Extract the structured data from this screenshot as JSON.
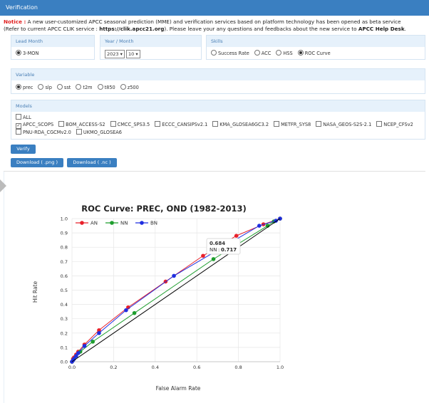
{
  "header": {
    "title": "Verification"
  },
  "notice": {
    "label": "Notice :",
    "text1": " A new user-customized APCC seasonal prediction (MME) and verification services based on platform technology has been opened as beta service",
    "text2": "(Refer to current APCC CLIK service : ",
    "link": "https://clik.apcc21.org",
    "text3": "). Please leave your any questions and feedbacks about the new service to ",
    "helpdesk": "APCC Help Desk",
    "end": "."
  },
  "lead": {
    "label": "Lead Month",
    "value": "3-MON"
  },
  "yearmonth": {
    "label": "Year / Month",
    "year": "2023",
    "month": "10"
  },
  "skills": {
    "label": "Skills",
    "options": [
      "Success Rate",
      "ACC",
      "HSS",
      "ROC Curve"
    ],
    "selected": "ROC Curve"
  },
  "variable": {
    "label": "Variable",
    "options": [
      "prec",
      "slp",
      "sst",
      "t2m",
      "t850",
      "z500"
    ],
    "selected": "prec"
  },
  "models": {
    "label": "Models",
    "all": "ALL",
    "items": [
      "APCC_SCOPS",
      "BOM_ACCESS-S2",
      "CMCC_SPS3.5",
      "ECCC_CANSIPSv2.1",
      "KMA_GLOSEA6GC3.2",
      "METFR_SYS8",
      "NASA_GEOS-S2S-2.1",
      "NCEP_CFSv2",
      "PNU-RDA_CGCMv2.0",
      "UKMO_GLOSEA6"
    ],
    "checked": [
      "APCC_SCOPS"
    ]
  },
  "buttons": {
    "verify": "Verify",
    "png": "Download ( .png )",
    "nc": "Download ( .nc )"
  },
  "chart_data": {
    "type": "line",
    "title": "ROC Curve: PREC, OND (1982-2013)",
    "xlabel": "False Alarm Rate",
    "ylabel": "Hit Rate",
    "xlim": [
      0,
      1
    ],
    "ylim": [
      0,
      1
    ],
    "xticks": [
      "0.0",
      "0.2",
      "0.4",
      "0.6",
      "0.8",
      "1.0"
    ],
    "yticks": [
      "0.0",
      "0.1",
      "0.2",
      "0.3",
      "0.4",
      "0.5",
      "0.6",
      "0.7",
      "0.8",
      "0.9",
      "1.0"
    ],
    "legend_position": "top-left",
    "series": [
      {
        "name": "AN",
        "color": "#e8202a",
        "x": [
          0,
          0.005,
          0.01,
          0.02,
          0.03,
          0.06,
          0.13,
          0.27,
          0.45,
          0.63,
          0.79,
          0.92,
          1.0
        ],
        "y": [
          0,
          0.02,
          0.03,
          0.05,
          0.07,
          0.12,
          0.22,
          0.38,
          0.56,
          0.74,
          0.88,
          0.96,
          1.0
        ]
      },
      {
        "name": "NN",
        "color": "#1e9e2e",
        "x": [
          0,
          0.01,
          0.02,
          0.04,
          0.1,
          0.3,
          0.68,
          0.94,
          0.97,
          1.0
        ],
        "y": [
          0,
          0.02,
          0.04,
          0.07,
          0.14,
          0.34,
          0.717,
          0.95,
          0.98,
          1.0
        ]
      },
      {
        "name": "BN",
        "color": "#1f2ee0",
        "x": [
          0,
          0.005,
          0.01,
          0.02,
          0.03,
          0.06,
          0.13,
          0.26,
          0.49,
          0.9,
          0.98,
          1.0
        ],
        "y": [
          0,
          0.01,
          0.02,
          0.04,
          0.06,
          0.11,
          0.2,
          0.36,
          0.6,
          0.95,
          0.985,
          1.0
        ]
      },
      {
        "name": "",
        "color": "#000000",
        "x": [
          0,
          1
        ],
        "y": [
          0,
          1
        ]
      }
    ],
    "tooltip": {
      "x": "0.684",
      "series": "NN",
      "y": "0.717"
    }
  }
}
